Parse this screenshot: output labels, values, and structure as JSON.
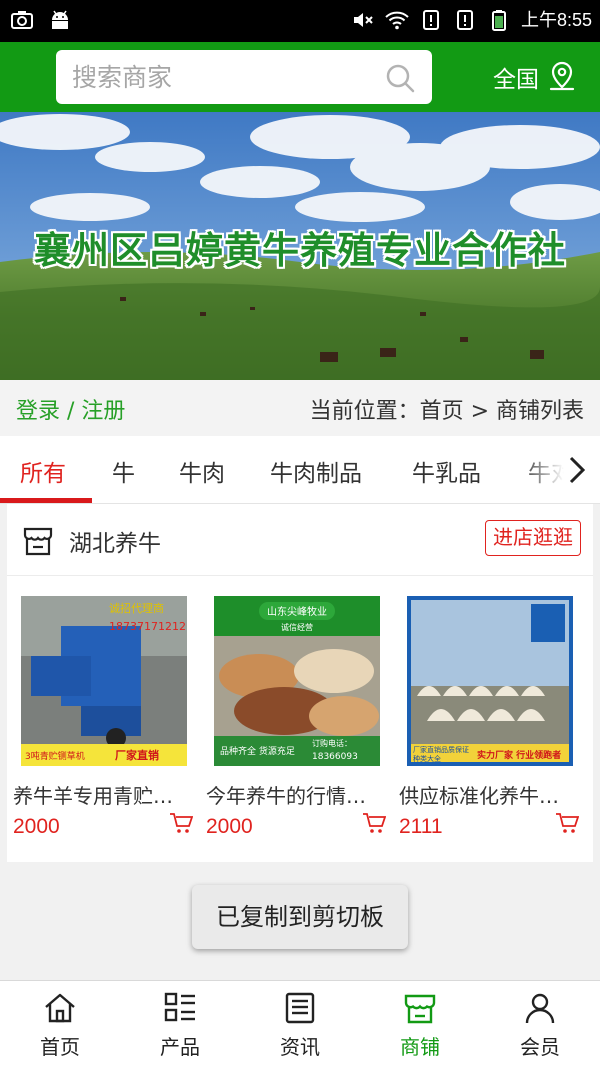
{
  "status_bar": {
    "time": "上午8:55"
  },
  "header": {
    "search_placeholder": "搜索商家",
    "region": "全国"
  },
  "banner": {
    "title": "襄州区吕婷黄牛养殖专业合作社"
  },
  "breadcrumb": {
    "login": "登录 / 注册",
    "location": "当前位置：首页 > 商铺列表"
  },
  "tabs": [
    {
      "label": "所有",
      "active": true
    },
    {
      "label": "牛"
    },
    {
      "label": "牛肉"
    },
    {
      "label": "牛肉制品"
    },
    {
      "label": "牛乳品"
    },
    {
      "label": "牛对"
    }
  ],
  "shop": {
    "name": "湖北养牛",
    "enter_label": "进店逛逛",
    "products": [
      {
        "name": "养牛羊专用青贮…",
        "price": "2000",
        "image_text": [
          "诚招代理商",
          "18737171212",
          "3吨青贮铡草机",
          "厂家直销"
        ]
      },
      {
        "name": "今年养牛的行情…",
        "price": "2000",
        "image_text": [
          "山东尖峰牧业",
          "诚信经营",
          "品种齐全 货源充足",
          "订购电话：",
          "18366093"
        ]
      },
      {
        "name": "供应标准化养牛…",
        "price": "2111",
        "image_text": [
          "厂家直销",
          "品质保证",
          "种类大全",
          "实力厂家 行业领跑者"
        ]
      }
    ]
  },
  "toast": "已复制到剪切板",
  "bottom_nav": [
    {
      "label": "首页",
      "icon": "home-icon"
    },
    {
      "label": "产品",
      "icon": "product-grid-icon"
    },
    {
      "label": "资讯",
      "icon": "news-icon"
    },
    {
      "label": "商铺",
      "icon": "store-icon",
      "active": true
    },
    {
      "label": "会员",
      "icon": "user-icon"
    }
  ],
  "colors": {
    "brand_green": "#129a14",
    "accent_red": "#e0231f",
    "link_green": "#27a027"
  }
}
